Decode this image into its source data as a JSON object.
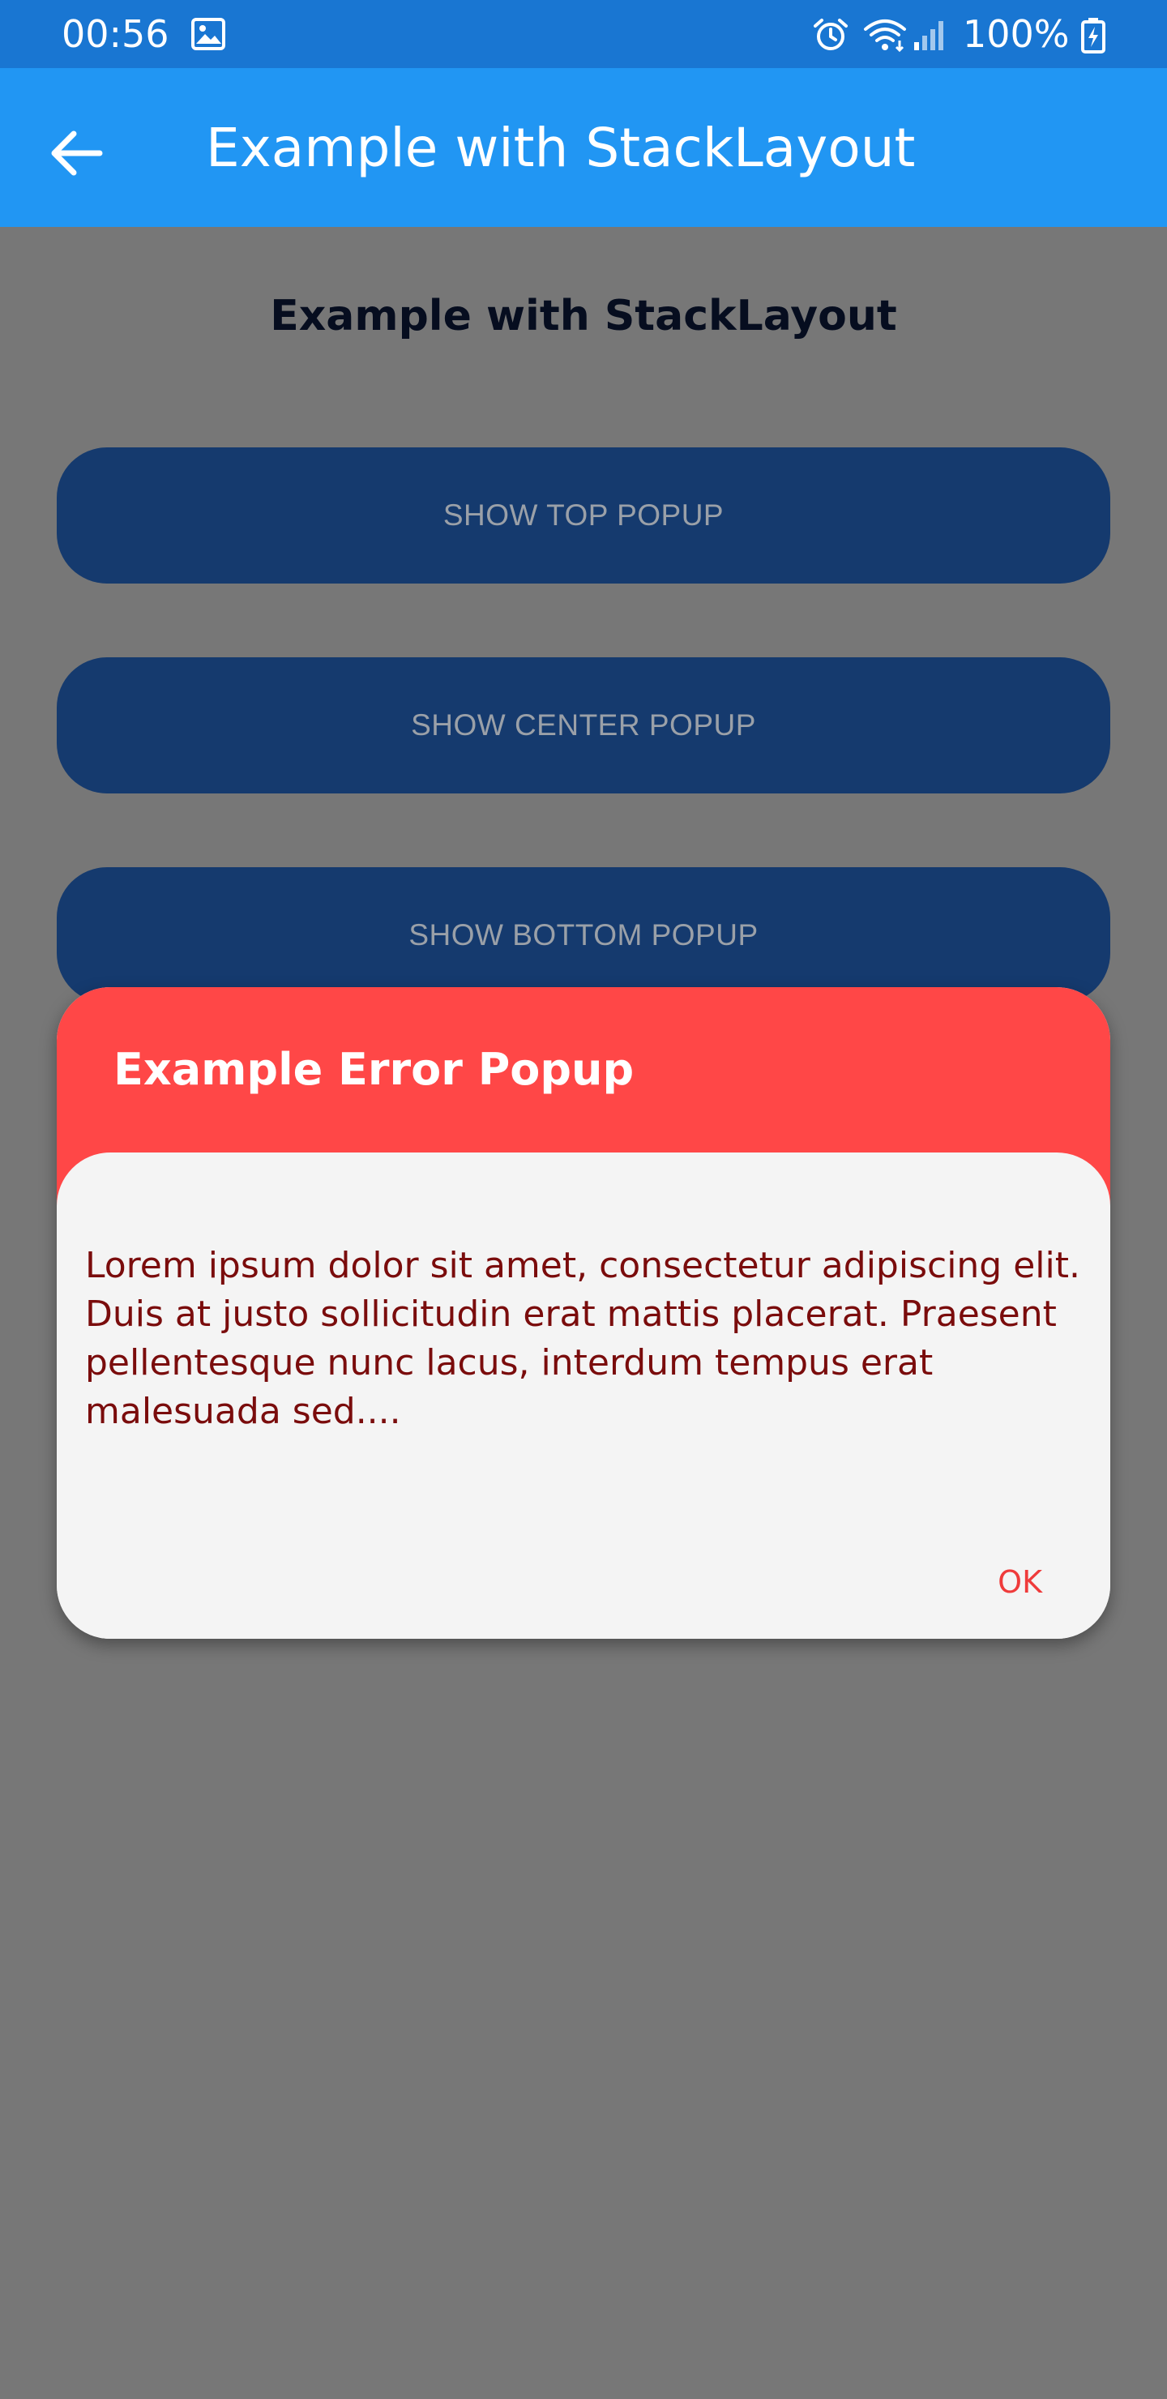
{
  "status_bar": {
    "time": "00:56",
    "battery": "100%",
    "icons": [
      "image-icon",
      "alarm-icon",
      "wifi-icon",
      "signal-icon",
      "battery-icon"
    ]
  },
  "app_bar": {
    "title": "Example with StackLayout",
    "back_icon": "arrow-left-icon"
  },
  "page": {
    "heading": "Example with StackLayout",
    "buttons": [
      {
        "label": "SHOW TOP POPUP"
      },
      {
        "label": "SHOW CENTER POPUP"
      },
      {
        "label": "SHOW BOTTOM POPUP"
      }
    ]
  },
  "dialog": {
    "title": "Example Error Popup",
    "message": "Lorem ipsum dolor sit amet, consectetur adipiscing elit. Duis at justo sollicitudin erat mattis placerat. Praesent pellentesque nunc lacus, interdum tempus erat malesuada sed....",
    "ok_label": "OK"
  },
  "colors": {
    "status_bar": "#1976D2",
    "app_bar": "#2196F3",
    "overlay": "#777777",
    "button_bg": "#153a6e",
    "dialog_header": "#ff4747",
    "dialog_body": "#f4f4f4",
    "message_text": "#7a0c0c",
    "ok_text": "#ef3b3b"
  }
}
